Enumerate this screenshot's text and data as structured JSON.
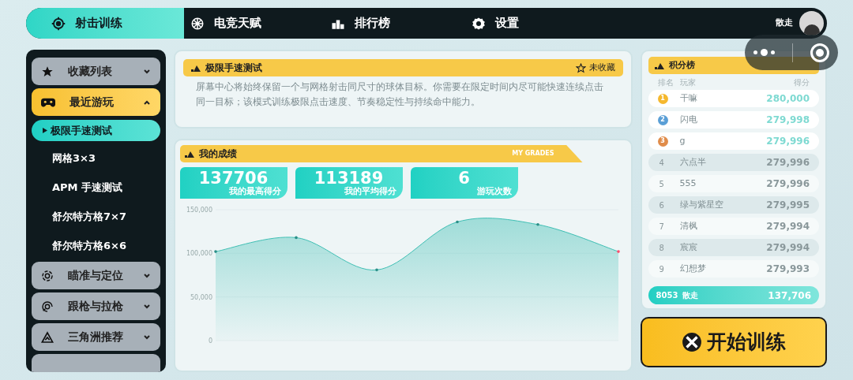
{
  "nav": {
    "tabs": [
      {
        "label": "射击训练",
        "selected": true
      },
      {
        "label": "电竞天赋",
        "selected": false
      },
      {
        "label": "排行榜",
        "selected": false
      },
      {
        "label": "设置",
        "selected": false
      }
    ],
    "user": "散走"
  },
  "sidebar": {
    "items": [
      {
        "label": "收藏列表",
        "selected": false,
        "expanded": false
      },
      {
        "label": "最近游玩",
        "selected": true,
        "expanded": true,
        "children": [
          {
            "label": "极限手速测试",
            "selected": true
          },
          {
            "label": "网格3×3",
            "selected": false
          },
          {
            "label": "APM 手速测试",
            "selected": false
          },
          {
            "label": "舒尔特方格7×7",
            "selected": false
          },
          {
            "label": "舒尔特方格6×6",
            "selected": false
          }
        ]
      },
      {
        "label": "瞄准与定位",
        "selected": false,
        "expanded": false
      },
      {
        "label": "跟枪与拉枪",
        "selected": false,
        "expanded": false
      },
      {
        "label": "三角洲推荐",
        "selected": false,
        "expanded": false
      }
    ]
  },
  "mode": {
    "title": "极限手速测试",
    "favorite": {
      "label": "未收藏",
      "on": false
    },
    "description": "屏幕中心将始终保留一个与网格射击同尺寸的球体目标。你需要在限定时间内尽可能快速连续点击同一目标；该模式训练极限点击速度、节奏稳定性与持续命中能力。"
  },
  "grades": {
    "title": "我的成绩",
    "subtitle": "MY GRADES",
    "stats": [
      {
        "value": "137706",
        "label": "我的最高得分"
      },
      {
        "value": "113189",
        "label": "我的平均得分"
      },
      {
        "value": "6",
        "label": "游玩次数"
      }
    ],
    "chart_data": {
      "type": "area",
      "values": [
        102000,
        118000,
        81000,
        136000,
        133000,
        102000
      ],
      "ylim": [
        0,
        150000
      ],
      "yticks": [
        {
          "value": 0,
          "label": "0"
        },
        {
          "value": 50000,
          "label": "50,000"
        },
        {
          "value": 100000,
          "label": "100,000"
        },
        {
          "value": 150000,
          "label": "150,000"
        }
      ]
    }
  },
  "leaderboard": {
    "title": "积分榜",
    "columns": [
      "排名",
      "玩家",
      "得分"
    ],
    "rows": [
      {
        "kind": "medal",
        "rank": "1",
        "color": "#f5b82e",
        "player": "干嘛",
        "score": "280,000"
      },
      {
        "kind": "medal",
        "rank": "2",
        "color": "#5a9fd6",
        "player": "闪电",
        "score": "279,998"
      },
      {
        "kind": "medal",
        "rank": "3",
        "color": "#e08c4a",
        "player": "g",
        "score": "279,996"
      },
      {
        "kind": "plain",
        "rank": "4",
        "player": "六点半",
        "score": "279,996"
      },
      {
        "kind": "plain",
        "rank": "5",
        "player": "555",
        "score": "279,996"
      },
      {
        "kind": "plain",
        "rank": "6",
        "player": "绿与紫星空",
        "score": "279,995"
      },
      {
        "kind": "plain",
        "rank": "7",
        "player": "清枫",
        "score": "279,994"
      },
      {
        "kind": "plain",
        "rank": "8",
        "player": "宸宸",
        "score": "279,994"
      },
      {
        "kind": "plain",
        "rank": "9",
        "player": "幻想梦",
        "score": "279,993"
      }
    ],
    "me": {
      "rank": "8053",
      "player": "散走",
      "score": "137,706"
    }
  },
  "start_button": "开始训练"
}
